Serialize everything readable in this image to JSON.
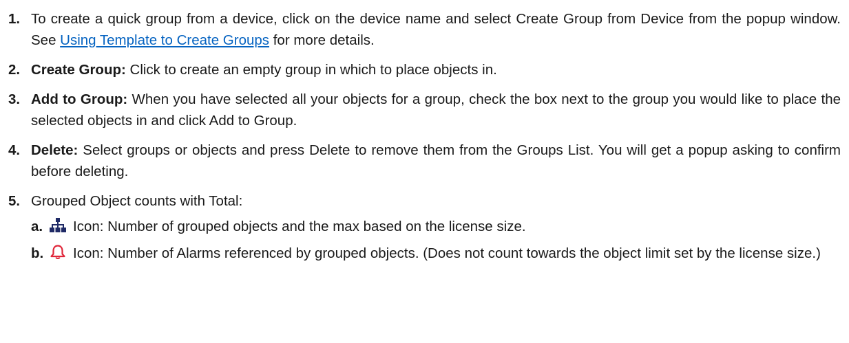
{
  "items": [
    {
      "number": "1.",
      "text_before": "To create a quick group from a device, click on the device name and select Create Group from Device from the popup window.  See ",
      "link_text": "Using Template to Create Groups",
      "text_after": " for more details."
    },
    {
      "number": "2.",
      "term": "Create Group:",
      "text": " Click to create an empty group in which to place objects in."
    },
    {
      "number": "3.",
      "term": "Add to Group:",
      "text": " When you have selected all your objects for a group, check the box next to the group you would like to place the selected objects in and click Add to Group."
    },
    {
      "number": "4.",
      "term": "Delete:",
      "text": " Select groups or objects and press Delete to remove them from the Groups List. You will get a popup asking to confirm before deleting."
    },
    {
      "number": "5.",
      "text": "Grouped Object counts with Total:"
    }
  ],
  "subitems": [
    {
      "letter": "a.",
      "icon": "hierarchy-icon",
      "term": "Icon:",
      "text": " Number of grouped objects and the max based on the license size."
    },
    {
      "letter": "b.",
      "icon": "bell-icon",
      "term": "Icon:",
      "text": " Number of Alarms referenced by grouped objects. (Does not count towards the object limit set by the license size.)"
    }
  ],
  "colors": {
    "link": "#0563c1",
    "hierarchy_icon": "#1f2a66",
    "bell_icon": "#e0263a"
  }
}
